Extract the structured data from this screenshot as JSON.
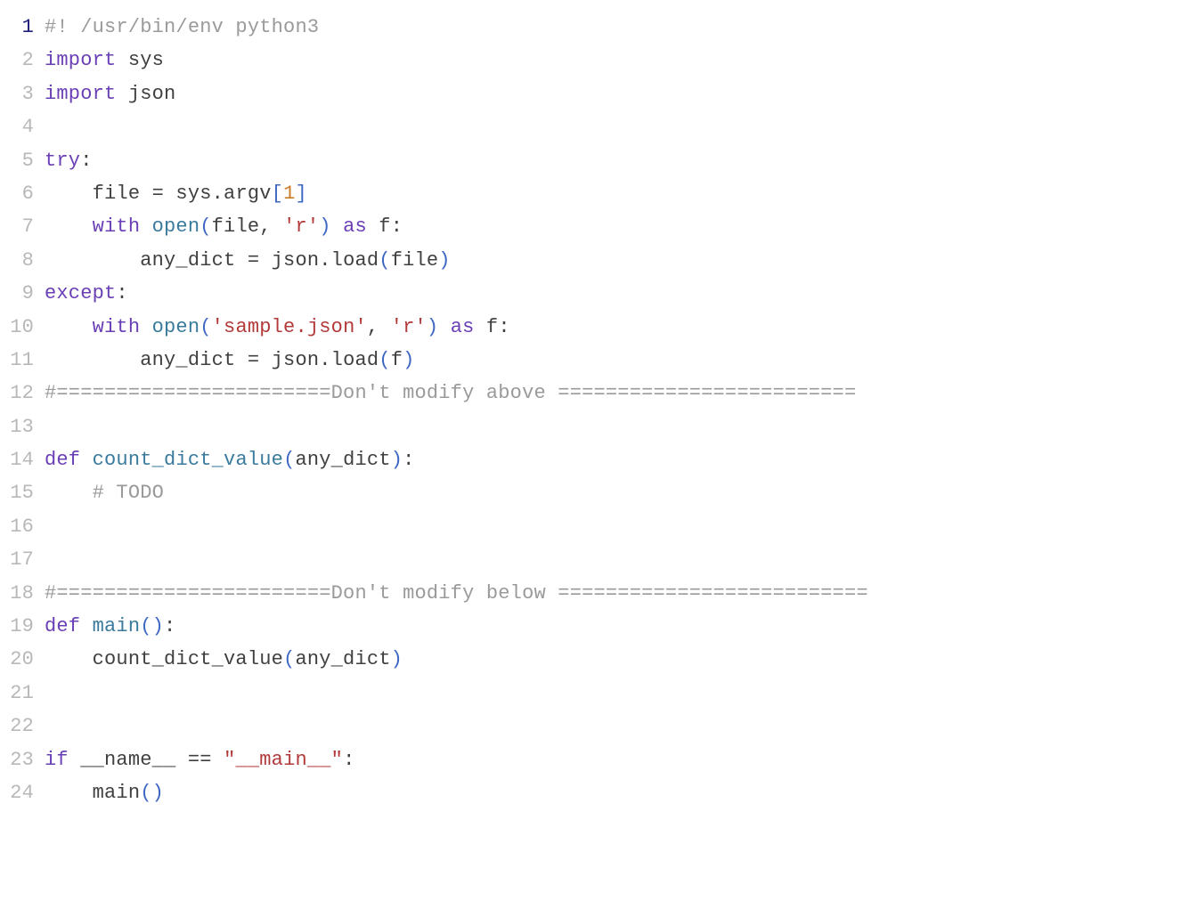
{
  "editor": {
    "current_line": 1,
    "lines": [
      {
        "n": 1,
        "tokens": [
          {
            "c": "comment",
            "t": "#! /usr/bin/env python3"
          }
        ]
      },
      {
        "n": 2,
        "tokens": [
          {
            "c": "keyword",
            "t": "import"
          },
          {
            "c": "ident",
            "t": " sys"
          }
        ]
      },
      {
        "n": 3,
        "tokens": [
          {
            "c": "keyword",
            "t": "import"
          },
          {
            "c": "ident",
            "t": " json"
          }
        ]
      },
      {
        "n": 4,
        "tokens": []
      },
      {
        "n": 5,
        "tokens": [
          {
            "c": "keyword",
            "t": "try"
          },
          {
            "c": "punct",
            "t": ":"
          }
        ]
      },
      {
        "n": 6,
        "tokens": [
          {
            "c": "ident",
            "t": "    file "
          },
          {
            "c": "punct",
            "t": "="
          },
          {
            "c": "ident",
            "t": " sys.argv"
          },
          {
            "c": "bracket",
            "t": "["
          },
          {
            "c": "num",
            "t": "1"
          },
          {
            "c": "bracket",
            "t": "]"
          }
        ]
      },
      {
        "n": 7,
        "tokens": [
          {
            "c": "ident",
            "t": "    "
          },
          {
            "c": "keyword",
            "t": "with"
          },
          {
            "c": "ident",
            "t": " "
          },
          {
            "c": "builtin",
            "t": "open"
          },
          {
            "c": "paren",
            "t": "("
          },
          {
            "c": "ident",
            "t": "file, "
          },
          {
            "c": "str",
            "t": "'r'"
          },
          {
            "c": "paren",
            "t": ")"
          },
          {
            "c": "ident",
            "t": " "
          },
          {
            "c": "keyword",
            "t": "as"
          },
          {
            "c": "ident",
            "t": " f:"
          }
        ]
      },
      {
        "n": 8,
        "tokens": [
          {
            "c": "ident",
            "t": "        any_dict "
          },
          {
            "c": "punct",
            "t": "="
          },
          {
            "c": "ident",
            "t": " json.load"
          },
          {
            "c": "paren",
            "t": "("
          },
          {
            "c": "ident",
            "t": "file"
          },
          {
            "c": "paren",
            "t": ")"
          }
        ]
      },
      {
        "n": 9,
        "tokens": [
          {
            "c": "keyword",
            "t": "except"
          },
          {
            "c": "punct",
            "t": ":"
          }
        ]
      },
      {
        "n": 10,
        "tokens": [
          {
            "c": "ident",
            "t": "    "
          },
          {
            "c": "keyword",
            "t": "with"
          },
          {
            "c": "ident",
            "t": " "
          },
          {
            "c": "builtin",
            "t": "open"
          },
          {
            "c": "paren",
            "t": "("
          },
          {
            "c": "str",
            "t": "'sample.json'"
          },
          {
            "c": "ident",
            "t": ", "
          },
          {
            "c": "str",
            "t": "'r'"
          },
          {
            "c": "paren",
            "t": ")"
          },
          {
            "c": "ident",
            "t": " "
          },
          {
            "c": "keyword",
            "t": "as"
          },
          {
            "c": "ident",
            "t": " f:"
          }
        ]
      },
      {
        "n": 11,
        "tokens": [
          {
            "c": "ident",
            "t": "        any_dict "
          },
          {
            "c": "punct",
            "t": "="
          },
          {
            "c": "ident",
            "t": " json.load"
          },
          {
            "c": "paren",
            "t": "("
          },
          {
            "c": "ident",
            "t": "f"
          },
          {
            "c": "paren",
            "t": ")"
          }
        ]
      },
      {
        "n": 12,
        "tokens": [
          {
            "c": "comment",
            "t": "#=======================Don't modify above ========================="
          }
        ]
      },
      {
        "n": 13,
        "tokens": []
      },
      {
        "n": 14,
        "tokens": [
          {
            "c": "keyword",
            "t": "def"
          },
          {
            "c": "ident",
            "t": " "
          },
          {
            "c": "builtin",
            "t": "count_dict_value"
          },
          {
            "c": "paren",
            "t": "("
          },
          {
            "c": "ident",
            "t": "any_dict"
          },
          {
            "c": "paren",
            "t": ")"
          },
          {
            "c": "punct",
            "t": ":"
          }
        ]
      },
      {
        "n": 15,
        "tokens": [
          {
            "c": "ident",
            "t": "    "
          },
          {
            "c": "comment",
            "t": "# TODO"
          }
        ]
      },
      {
        "n": 16,
        "tokens": []
      },
      {
        "n": 17,
        "tokens": []
      },
      {
        "n": 18,
        "tokens": [
          {
            "c": "comment",
            "t": "#=======================Don't modify below =========================="
          }
        ]
      },
      {
        "n": 19,
        "tokens": [
          {
            "c": "keyword",
            "t": "def"
          },
          {
            "c": "ident",
            "t": " "
          },
          {
            "c": "builtin",
            "t": "main"
          },
          {
            "c": "paren",
            "t": "()"
          },
          {
            "c": "punct",
            "t": ":"
          }
        ]
      },
      {
        "n": 20,
        "tokens": [
          {
            "c": "ident",
            "t": "    count_dict_value"
          },
          {
            "c": "paren",
            "t": "("
          },
          {
            "c": "ident",
            "t": "any_dict"
          },
          {
            "c": "paren",
            "t": ")"
          }
        ]
      },
      {
        "n": 21,
        "tokens": []
      },
      {
        "n": 22,
        "tokens": []
      },
      {
        "n": 23,
        "tokens": [
          {
            "c": "keyword",
            "t": "if"
          },
          {
            "c": "ident",
            "t": " __name__ "
          },
          {
            "c": "punct",
            "t": "=="
          },
          {
            "c": "ident",
            "t": " "
          },
          {
            "c": "str",
            "t": "\"__main__\""
          },
          {
            "c": "punct",
            "t": ":"
          }
        ]
      },
      {
        "n": 24,
        "tokens": [
          {
            "c": "ident",
            "t": "    main"
          },
          {
            "c": "paren",
            "t": "()"
          }
        ]
      }
    ]
  }
}
